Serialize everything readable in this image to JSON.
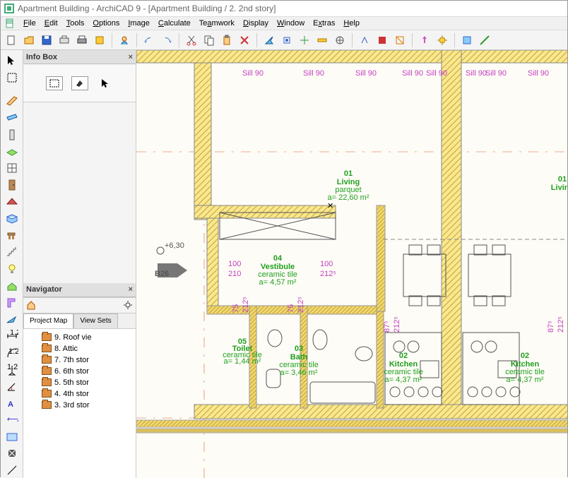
{
  "window": {
    "title": "Apartment Building - ArchiCAD 9 - [Apartment Building / 2. 2nd story]"
  },
  "menu": {
    "file": "File",
    "edit": "Edit",
    "tools": "Tools",
    "options": "Options",
    "image": "Image",
    "calculate": "Calculate",
    "teamwork": "Teamwork",
    "display": "Display",
    "window": "Window",
    "extras": "Extras",
    "help": "Help"
  },
  "panels": {
    "infobox_title": "Info Box",
    "navigator_title": "Navigator",
    "tabs": {
      "project_map": "Project Map",
      "view_sets": "View Sets"
    }
  },
  "tree": [
    {
      "label": "9. Roof vie"
    },
    {
      "label": "8. Attic"
    },
    {
      "label": "7. 7th stor"
    },
    {
      "label": "6. 6th stor"
    },
    {
      "label": "5. 5th stor"
    },
    {
      "label": "4. 4th stor"
    },
    {
      "label": "3. 3rd stor"
    }
  ],
  "floorplan": {
    "elev_marker": "+6,30",
    "section_label": "B26",
    "sill_labels": [
      "Sill 90",
      "Sill 90",
      "Sill 90",
      "Sill 90",
      "Sill 90",
      "Sill 90",
      "Sill 90",
      "Sill 90"
    ],
    "dims": {
      "d100a": "100",
      "d210": "210",
      "d100b": "100",
      "d2125": "212⁵",
      "d75a": "75",
      "d2125b": "212⁵",
      "d75b": "75",
      "d2125c": "212⁵",
      "d875a": "87⁵",
      "d2125d": "212⁵",
      "d875b": "87⁵",
      "d2125e": "212⁵"
    },
    "rooms": {
      "living": {
        "num": "01",
        "name": "Living",
        "mat": "parquet",
        "area": "a= 22,60 m²"
      },
      "vestibule": {
        "num": "04",
        "name": "Vestibule",
        "mat": "ceramic tile",
        "area": "a= 4,57 m²"
      },
      "toilet": {
        "num": "05",
        "name": "Toilet",
        "mat": "ceramic tile",
        "area": "a= 1,44 m²"
      },
      "bath": {
        "num": "03",
        "name": "Bath",
        "mat": "ceramic tile",
        "area": "a= 3,46 m²"
      },
      "kitchen1": {
        "num": "02",
        "name": "Kitchen",
        "mat": "ceramic tile",
        "area": "a= 4,37 m²"
      },
      "kitchen2": {
        "num": "02",
        "name": "Kitchen",
        "mat": "ceramic tile",
        "area": "a= 4,37 m²"
      },
      "living2": {
        "num": "01",
        "name": "Living"
      }
    }
  }
}
